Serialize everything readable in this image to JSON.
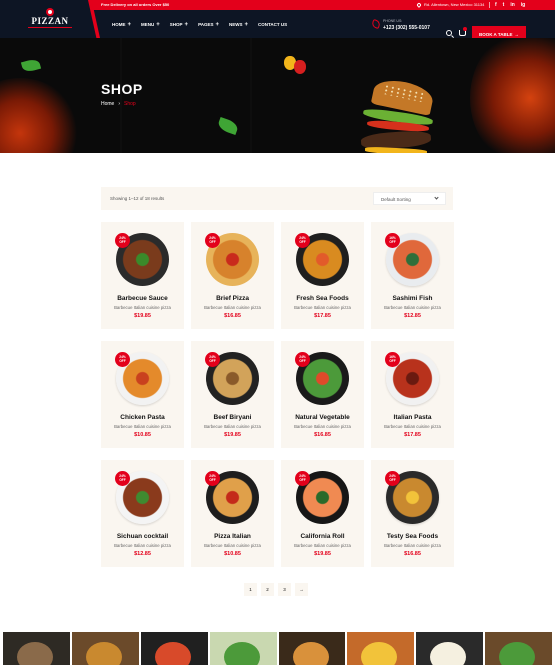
{
  "topbar": {
    "promo": "Free Delivery on all orders Over $50",
    "address": "Rd. Allentown, New Mexico 31134",
    "social": [
      "f",
      "t",
      "in",
      "ig"
    ]
  },
  "brand": {
    "name": "PIZZAN"
  },
  "nav": [
    {
      "label": "HOME",
      "has_dropdown": true
    },
    {
      "label": "MENU",
      "has_dropdown": true
    },
    {
      "label": "SHOP",
      "has_dropdown": true
    },
    {
      "label": "PAGES",
      "has_dropdown": true
    },
    {
      "label": "NEWS",
      "has_dropdown": true
    },
    {
      "label": "CONTACT US",
      "has_dropdown": false
    }
  ],
  "header": {
    "phone_label": "PHONE US:",
    "phone_number": "+123 (302) 555-0107",
    "book_button": "BOOK A TABLE",
    "icons": [
      "search-icon",
      "cart-icon",
      "phone-icon"
    ]
  },
  "banner": {
    "title": "SHOP",
    "breadcrumb": [
      "Home",
      "Shop"
    ]
  },
  "toolbar": {
    "result_count": "Showing 1–12 of 18 results",
    "sort_selected": "Default Sorting"
  },
  "products": [
    {
      "name": "Barbecue Sauce",
      "desc": "Barbecue Italian cuisine pizza",
      "price": "$19.85",
      "badge_pct": "24%",
      "badge_off": "OFF",
      "plate": "#2b2b2b",
      "food": "#7a3b1c",
      "accent": "#3a8a2a"
    },
    {
      "name": "Brief Pizza",
      "desc": "Barbecue Italian cuisine pizza",
      "price": "$16.85",
      "badge_pct": "24%",
      "badge_off": "OFF",
      "plate": "#e7b35a",
      "food": "#d7822c",
      "accent": "#c92a1c"
    },
    {
      "name": "Fresh Sea Foods",
      "desc": "Barbecue Italian cuisine pizza",
      "price": "$17.85",
      "badge_pct": "24%",
      "badge_off": "OFF",
      "plate": "#1f1f1f",
      "food": "#d98b20",
      "accent": "#e25b2a"
    },
    {
      "name": "Sashimi Fish",
      "desc": "Barbecue Italian cuisine pizza",
      "price": "$12.85",
      "badge_pct": "16%",
      "badge_off": "OFF",
      "plate": "#e9ecef",
      "food": "#e0683b",
      "accent": "#2f6f3a"
    },
    {
      "name": "Chicken Pasta",
      "desc": "Barbecue Italian cuisine pizza",
      "price": "$10.85",
      "badge_pct": "24%",
      "badge_off": "OFF",
      "plate": "#f2f2f2",
      "food": "#e48a2b",
      "accent": "#c9411e"
    },
    {
      "name": "Beef Biryani",
      "desc": "Barbecue Italian cuisine pizza",
      "price": "$19.85",
      "badge_pct": "24%",
      "badge_off": "OFF",
      "plate": "#222222",
      "food": "#d2a35a",
      "accent": "#8a5a2a"
    },
    {
      "name": "Natural Vegetable",
      "desc": "Barbecue Italian cuisine pizza",
      "price": "$16.85",
      "badge_pct": "24%",
      "badge_off": "OFF",
      "plate": "#1a1a1a",
      "food": "#4c9a3a",
      "accent": "#e04a2a"
    },
    {
      "name": "Italian Pasta",
      "desc": "Barbecue Italian cuisine pizza",
      "price": "$17.85",
      "badge_pct": "16%",
      "badge_off": "OFF",
      "plate": "#f1f1f1",
      "food": "#b8321c",
      "accent": "#6a1a10"
    },
    {
      "name": "Sichuan cocktail",
      "desc": "Barbecue Italian cuisine pizza",
      "price": "$12.85",
      "badge_pct": "24%",
      "badge_off": "OFF",
      "plate": "#f4f4f4",
      "food": "#8a3a1c",
      "accent": "#3f8a30"
    },
    {
      "name": "Pizza Italian",
      "desc": "Barbecue Italian cuisine pizza",
      "price": "$10.85",
      "badge_pct": "24%",
      "badge_off": "OFF",
      "plate": "#1e1e1e",
      "food": "#e0a04a",
      "accent": "#c42a1a"
    },
    {
      "name": "California Roll",
      "desc": "Barbecue Italian cuisine pizza",
      "price": "$19.85",
      "badge_pct": "24%",
      "badge_off": "OFF",
      "plate": "#161616",
      "food": "#f08a52",
      "accent": "#2a6a2a"
    },
    {
      "name": "Testy Sea Foods",
      "desc": "Barbecue Italian cuisine pizza",
      "price": "$16.85",
      "badge_pct": "24%",
      "badge_off": "OFF",
      "plate": "#2a2a2a",
      "food": "#c9892f",
      "accent": "#f2c33a"
    }
  ],
  "pagination": {
    "pages": [
      "1",
      "2",
      "3"
    ],
    "next_icon": "arrow-right-icon"
  },
  "gallery": [
    {
      "bg": "#2e2a24",
      "dot": "#8a6a4a"
    },
    {
      "bg": "#6b4a2a",
      "dot": "#c9892f"
    },
    {
      "bg": "#202020",
      "dot": "#d84a2a"
    },
    {
      "bg": "#c9d8b0",
      "dot": "#4c9a3a"
    },
    {
      "bg": "#3a2a1a",
      "dot": "#d9913b"
    },
    {
      "bg": "#c46a2a",
      "dot": "#f2c33a"
    },
    {
      "bg": "#2a2a2a",
      "dot": "#f5f0e0"
    },
    {
      "bg": "#6a4a2a",
      "dot": "#4c9a3a"
    }
  ],
  "colors": {
    "accent": "#e3001b",
    "dark": "#0d1524",
    "card_bg": "#faf6f0"
  }
}
